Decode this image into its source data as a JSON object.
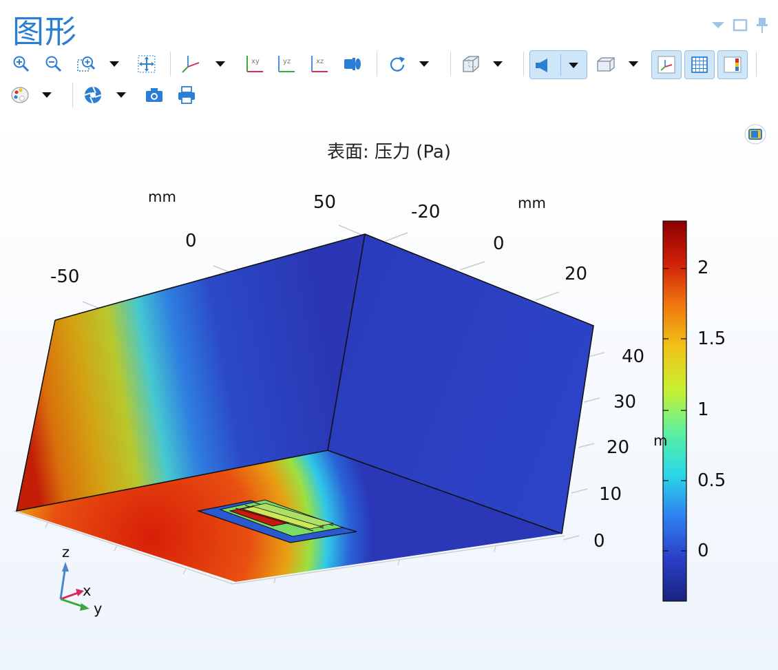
{
  "window": {
    "title": "图形"
  },
  "plot": {
    "title": "表面: 压力 (Pa)",
    "x_axis": {
      "unit": "mm",
      "ticks": [
        "-50",
        "0",
        "50"
      ]
    },
    "y_axis": {
      "unit": "mm",
      "ticks": [
        "-20",
        "0",
        "20"
      ]
    },
    "z_axis": {
      "unit_clipped": "m",
      "ticks": [
        "0",
        "10",
        "20",
        "30",
        "40"
      ]
    },
    "colorbar": {
      "ticks": [
        "2",
        "1.5",
        "1",
        "0.5",
        "0"
      ],
      "colormap": [
        "#1a237e",
        "#2a3fc8",
        "#2f7ff0",
        "#2ad7e8",
        "#5cf0a0",
        "#c8f032",
        "#f0c418",
        "#f07810",
        "#d02008",
        "#8a0000"
      ]
    },
    "triad": {
      "x": "x",
      "y": "y",
      "z": "z"
    }
  },
  "toolbar": {
    "icons": [
      "zoom-in-icon",
      "zoom-out-icon",
      "zoom-box-icon",
      "zoom-extents-icon",
      "view-axes-icon",
      "view-xy-icon",
      "view-yz-icon",
      "view-xz-icon",
      "camera-view-icon",
      "rotate-icon",
      "transparency-icon",
      "scene-light-icon",
      "wireframe-icon",
      "axis-orientation-icon",
      "grid-icon",
      "legend-icon",
      "color-table-icon",
      "image-snapshot-icon",
      "screenshot-icon",
      "print-icon"
    ]
  },
  "colors": {
    "accent": "#2a7fd4",
    "toggle_active_bg": "#cfe5f8"
  }
}
